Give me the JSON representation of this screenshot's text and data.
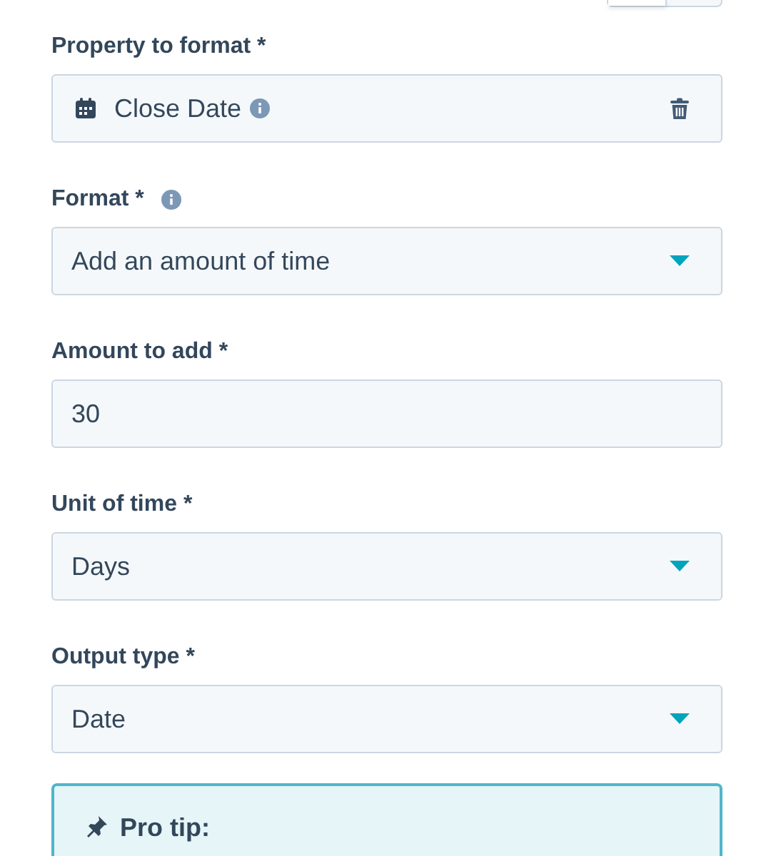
{
  "fields": [
    {
      "kind": "property",
      "label": "Property to format *",
      "value": "Close Date",
      "info": false
    },
    {
      "kind": "select",
      "label": "Format *",
      "value": "Add an amount of time",
      "info": true
    },
    {
      "kind": "input",
      "label": "Amount to add *",
      "value": "30",
      "info": false
    },
    {
      "kind": "select",
      "label": "Unit of time *",
      "value": "Days",
      "info": false
    },
    {
      "kind": "select",
      "label": "Output type *",
      "value": "Date",
      "info": false
    }
  ],
  "tip": {
    "title": "Pro tip:"
  }
}
